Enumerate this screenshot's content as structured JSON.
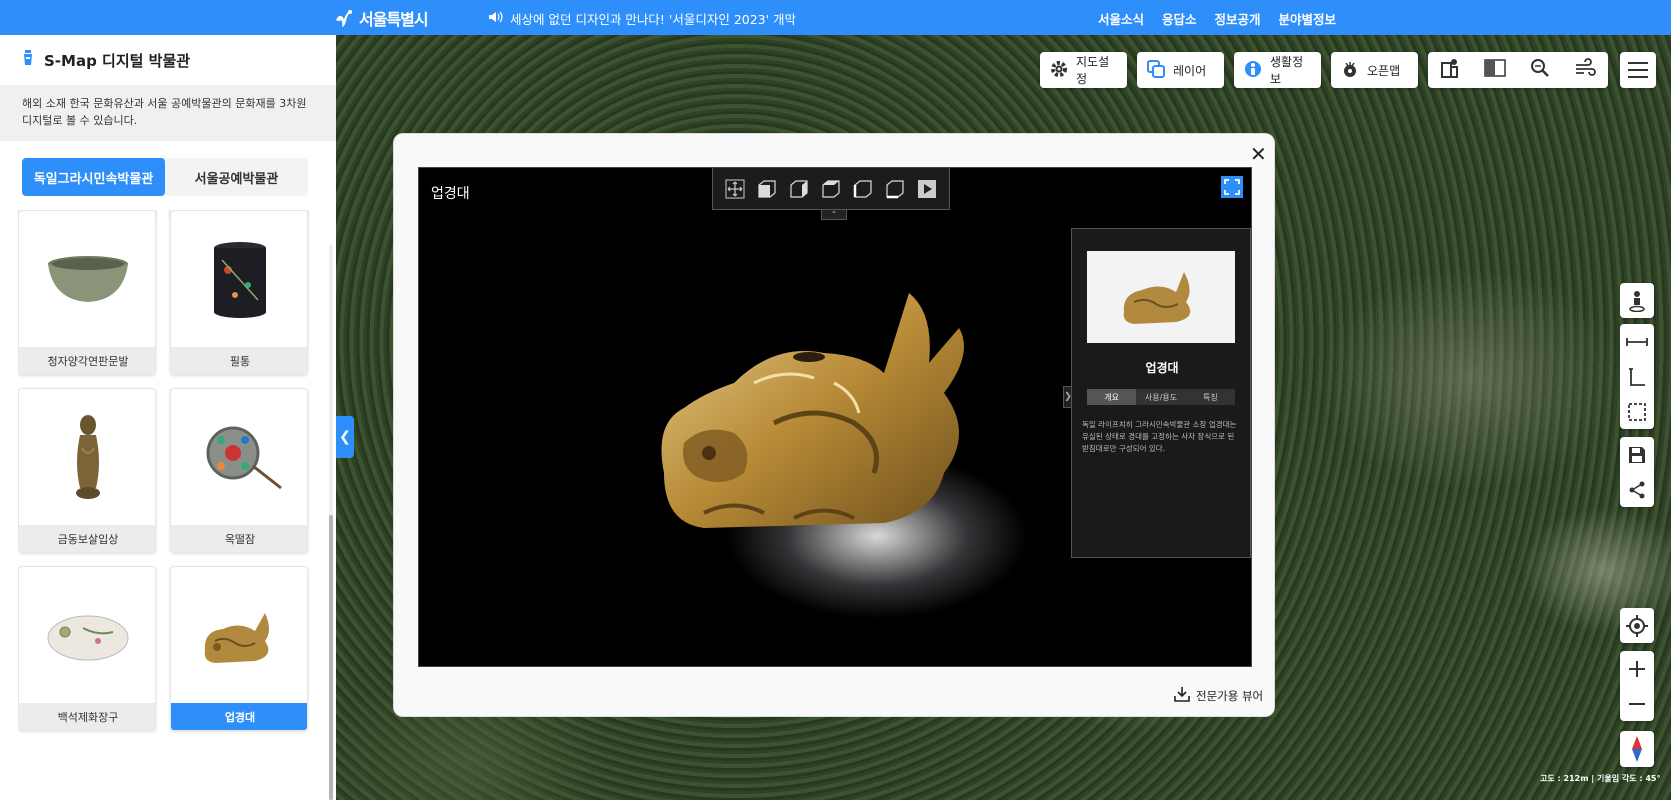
{
  "header": {
    "logo_text": "서울특별시",
    "notice": "세상에 없던 디자인과 만나다! '서울디자인 2023' 개막",
    "nav": [
      "서울소식",
      "응답소",
      "정보공개",
      "분야별정보"
    ],
    "brand_color": "#2e8efa"
  },
  "panel": {
    "title": "S-Map 디지털 박물관",
    "description": "해외 소재 한국 문화유산과 서울 공예박물관의 문화재를 3차원 디지털로 볼 수 있습니다.",
    "tabs": [
      {
        "label": "독일그라시민속박물관",
        "active": true
      },
      {
        "label": "서울공예박물관",
        "active": false
      }
    ],
    "items": [
      {
        "label": "청자양각연판문발",
        "icon": "celadon-bowl"
      },
      {
        "label": "필통",
        "icon": "brush-holder"
      },
      {
        "label": "금동보살입상",
        "icon": "bodhisattva-statue"
      },
      {
        "label": "옥떨잠",
        "icon": "jade-hairpin"
      },
      {
        "label": "백석제화장구",
        "icon": "cosmetic-case"
      },
      {
        "label": "업경대",
        "icon": "mirror-stand",
        "selected": true
      }
    ]
  },
  "toolbar": {
    "map_settings": "지도설정",
    "layers": "레이어",
    "life_info": "생활정보",
    "open_map": "오픈맵"
  },
  "status": {
    "scale_info": "고도 : 212m | 기울임 각도 : 45°"
  },
  "modal": {
    "viewer_title": "업경대",
    "info": {
      "name": "업경대",
      "tabs": [
        "개요",
        "사용/용도",
        "특징"
      ],
      "active_tab": "개요",
      "description": "독일 라이프치히 그라시민속박물관 소장 업경대는 유실된 상태로 경대를 고정하는 사자 장식으로 된 받침대로만 구성되어 있다."
    },
    "pro_viewer_label": "전문가용 뷰어"
  }
}
